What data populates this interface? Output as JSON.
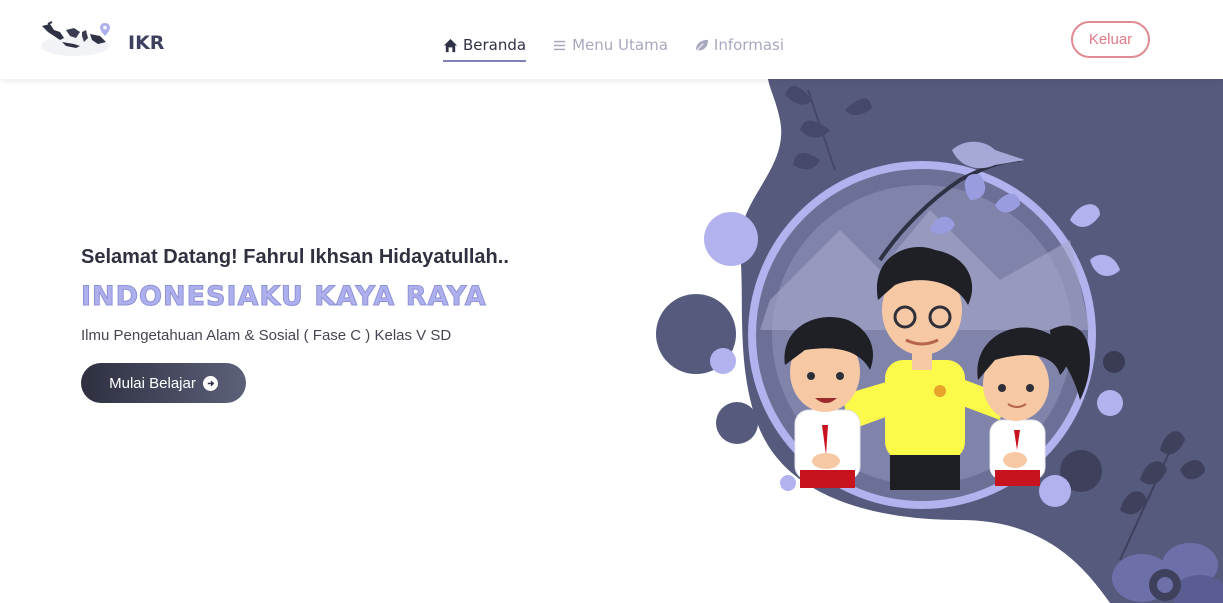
{
  "brand": {
    "name": "IKR"
  },
  "nav": {
    "items": [
      {
        "label": "Beranda",
        "icon": "home-icon",
        "active": true
      },
      {
        "label": "Menu Utama",
        "icon": "menu-icon",
        "active": false
      },
      {
        "label": "Informasi",
        "icon": "leaf-icon",
        "active": false
      }
    ]
  },
  "logout_label": "Keluar",
  "hero": {
    "greeting": "Selamat Datang! Fahrul Ikhsan Hidayatullah..",
    "title": "INDONESIAKU KAYA RAYA",
    "subtitle": "Ilmu Pengetahuan Alam & Sosial ( Fase C ) Kelas V SD",
    "button_label": "Mulai Belajar"
  },
  "colors": {
    "navy": "#565a7d",
    "lavender": "#aeb0ee",
    "accent_red": "#e07a84"
  }
}
